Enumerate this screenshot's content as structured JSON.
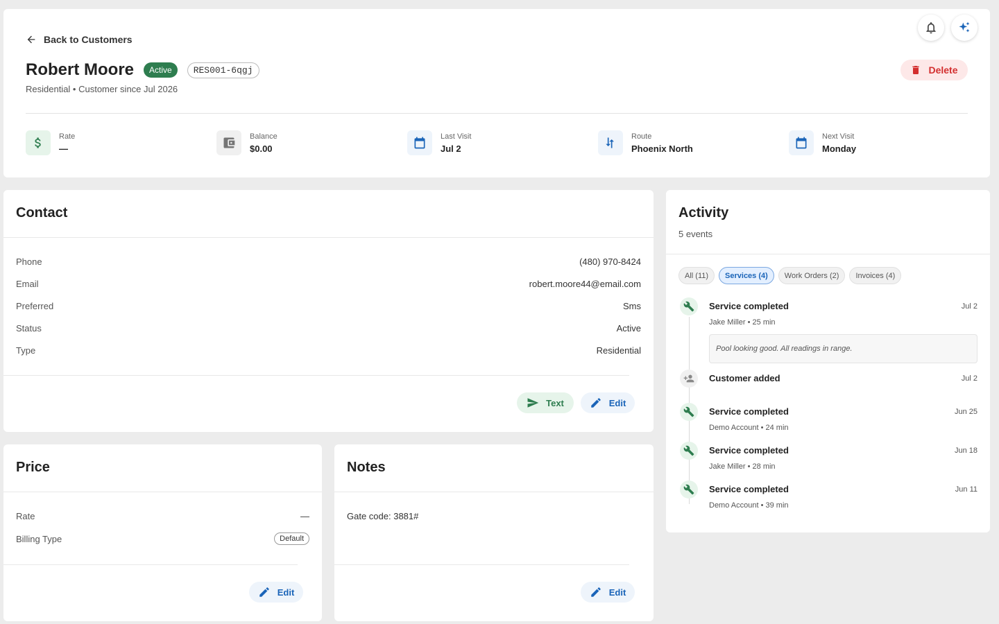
{
  "header": {
    "back_label": "Back to Customers",
    "name": "Robert Moore",
    "status": "Active",
    "code": "RES001-6qgj",
    "subtitle": "Residential • Customer since Jul 2026",
    "delete_label": "Delete",
    "stats": [
      {
        "label": "Rate",
        "value": "—",
        "icon": "dollar-icon",
        "color": "#2e7d4f"
      },
      {
        "label": "Balance",
        "value": "$0.00",
        "icon": "wallet-icon",
        "color": "#757575"
      },
      {
        "label": "Last Visit",
        "value": "Jul 2",
        "icon": "calendar-icon",
        "color": "#1a64b8"
      },
      {
        "label": "Route",
        "value": "Phoenix North",
        "icon": "route-icon",
        "color": "#1a64b8"
      },
      {
        "label": "Next Visit",
        "value": "Monday",
        "icon": "calendar-icon",
        "color": "#1a64b8"
      }
    ]
  },
  "contact": {
    "title": "Contact",
    "rows": [
      {
        "label": "Phone",
        "value": "(480) 970-8424"
      },
      {
        "label": "Email",
        "value": "robert.moore44@email.com"
      },
      {
        "label": "Preferred",
        "value": "Sms"
      },
      {
        "label": "Status",
        "value": "Active"
      },
      {
        "label": "Type",
        "value": "Residential"
      }
    ],
    "text_label": "Text",
    "edit_label": "Edit"
  },
  "price": {
    "title": "Price",
    "rate_label": "Rate",
    "rate_value": "—",
    "billing_label": "Billing Type",
    "billing_value": "Default",
    "edit_label": "Edit"
  },
  "notes": {
    "title": "Notes",
    "text": "Gate code: 3881#",
    "edit_label": "Edit"
  },
  "activity": {
    "title": "Activity",
    "subtitle": "5 events",
    "filters": [
      "All (11)",
      "Services (4)",
      "Work Orders (2)",
      "Invoices (4)"
    ],
    "items": [
      {
        "title": "Service completed",
        "date": "Jul 2",
        "meta": "Jake Miller • 25 min",
        "note": "Pool looking good. All readings in range.",
        "icon": "wrench-icon"
      },
      {
        "title": "Customer added",
        "date": "Jul 2",
        "meta": "",
        "icon": "person-add-icon"
      },
      {
        "title": "Service completed",
        "date": "Jun 25",
        "meta": "Demo Account • 24 min",
        "icon": "wrench-icon"
      },
      {
        "title": "Service completed",
        "date": "Jun 18",
        "meta": "Jake Miller • 28 min",
        "icon": "wrench-icon"
      },
      {
        "title": "Service completed",
        "date": "Jun 11",
        "meta": "Demo Account • 39 min",
        "icon": "wrench-icon"
      }
    ]
  },
  "colors": {
    "accent": "#1a64b8",
    "success": "#2e7d4f",
    "danger": "#d32f2f"
  }
}
